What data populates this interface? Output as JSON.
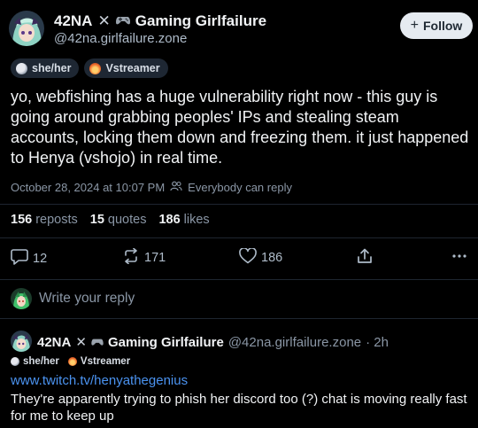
{
  "post": {
    "author": {
      "name_part1": "42NA",
      "name_part2": "Gaming Girlfailure",
      "handle": "@42na.girlfailure.zone",
      "badges": [
        {
          "label": "she/her",
          "icon": "moon-icon"
        },
        {
          "label": "Vstreamer",
          "icon": "flame-icon"
        }
      ]
    },
    "follow_label": "Follow",
    "follow_plus": "+",
    "text": "yo, webfishing has a huge vulnerability right now - this guy is going around grabbing peoples' IPs and stealing steam accounts, locking them down and freezing them. it just happened to Henya (vshojo) in real time.",
    "timestamp": "October 28, 2024 at 10:07 PM",
    "visibility": "Everybody can reply",
    "stats": {
      "reposts_count": "156",
      "reposts_label": "reposts",
      "quotes_count": "15",
      "quotes_label": "quotes",
      "likes_count": "186",
      "likes_label": "likes"
    },
    "actions": {
      "replies": "12",
      "reposts": "171",
      "likes": "186"
    }
  },
  "composer": {
    "placeholder": "Write your reply"
  },
  "reply": {
    "name_part1": "42NA",
    "name_part2": "Gaming Girlfailure",
    "handle": "@42na.girlfailure.zone",
    "time": "· 2h",
    "badges": [
      {
        "label": "she/her",
        "icon": "moon-icon"
      },
      {
        "label": "Vstreamer",
        "icon": "flame-icon"
      }
    ],
    "link": "www.twitch.tv/henyathegenius",
    "text": "They're apparently trying to phish her discord too (?) chat is moving really fast for me to keep up"
  },
  "colors": {
    "background": "#000000",
    "text": "#f1f3f5",
    "muted": "#8a96a5",
    "link": "#4b93f0",
    "follow_bg": "#e6ebf1"
  }
}
